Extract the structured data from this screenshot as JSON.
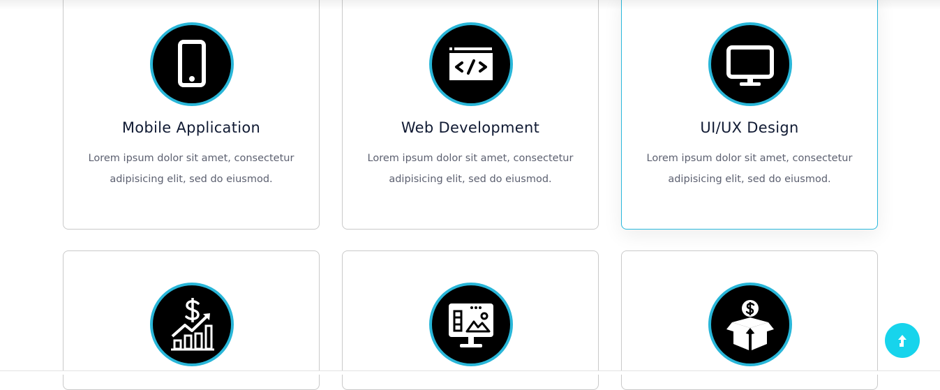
{
  "services": {
    "items": [
      {
        "title": "Mobile Application",
        "description": "Lorem ipsum dolor sit amet, consectetur adipisicing elit, sed do eiusmod.",
        "icon": "mobile-phone-icon"
      },
      {
        "title": "Web Development",
        "description": "Lorem ipsum dolor sit amet, consectetur adipisicing elit, sed do eiusmod.",
        "icon": "code-window-icon"
      },
      {
        "title": "UI/UX Design",
        "description": "Lorem ipsum dolor sit amet, consectetur adipisicing elit, sed do eiusmod.",
        "icon": "monitor-icon"
      },
      {
        "title": "",
        "description": "",
        "icon": "dollar-growth-chart-icon"
      },
      {
        "title": "",
        "description": "",
        "icon": "dashboard-monitor-icon"
      },
      {
        "title": "",
        "description": "",
        "icon": "money-box-icon"
      }
    ],
    "active_index": 2
  },
  "scroll_top": {
    "icon": "arrow-up-icon"
  },
  "colors": {
    "accent": "#29b6d8",
    "icon_background": "#000000",
    "title_text": "#101a33",
    "body_text": "#5c6070",
    "card_border": "#c9c9c9",
    "scroll_button": "#17d4ec"
  }
}
